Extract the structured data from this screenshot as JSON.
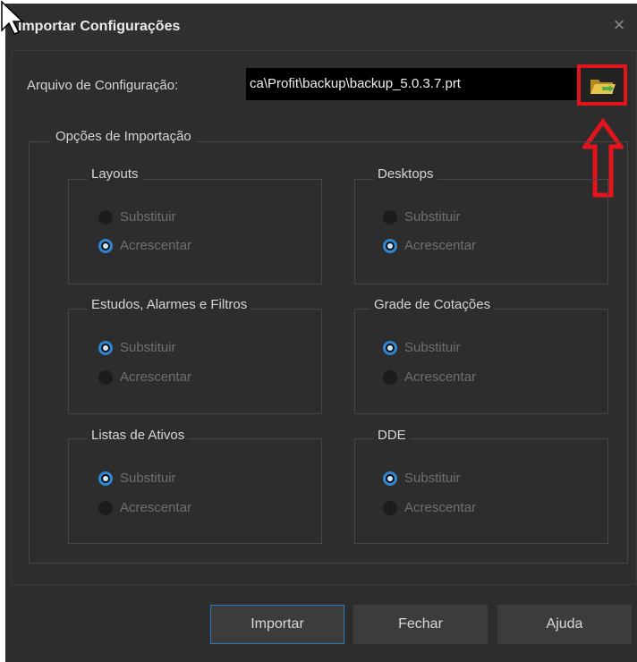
{
  "window": {
    "title": "Importar Configurações",
    "close_glyph": "×"
  },
  "file": {
    "label": "Arquivo de Configuração:",
    "value": "ca\\Profit\\backup\\backup_5.0.3.7.prt",
    "browse_icon": "folder-open-icon",
    "highlight_color": "#e3141c"
  },
  "options": {
    "legend": "Opções de Importação",
    "groups": [
      {
        "title": "Layouts",
        "options": [
          {
            "label": "Substituir",
            "checked": false
          },
          {
            "label": "Acrescentar",
            "checked": true
          }
        ]
      },
      {
        "title": "Desktops",
        "options": [
          {
            "label": "Substituir",
            "checked": false
          },
          {
            "label": "Acrescentar",
            "checked": true
          }
        ]
      },
      {
        "title": "Estudos, Alarmes e Filtros",
        "options": [
          {
            "label": "Substituir",
            "checked": true
          },
          {
            "label": "Acrescentar",
            "checked": false
          }
        ]
      },
      {
        "title": "Grade de Cotações",
        "options": [
          {
            "label": "Substituir",
            "checked": true
          },
          {
            "label": "Acrescentar",
            "checked": false
          }
        ]
      },
      {
        "title": "Listas de Ativos",
        "options": [
          {
            "label": "Substituir",
            "checked": true
          },
          {
            "label": "Acrescentar",
            "checked": false
          }
        ]
      },
      {
        "title": "DDE",
        "options": [
          {
            "label": "Substituir",
            "checked": true
          },
          {
            "label": "Acrescentar",
            "checked": false
          }
        ]
      }
    ]
  },
  "buttons": {
    "import": "Importar",
    "close": "Fechar",
    "help": "Ajuda"
  },
  "colors": {
    "accent": "#2f86d2",
    "background": "#2d2d2d"
  }
}
